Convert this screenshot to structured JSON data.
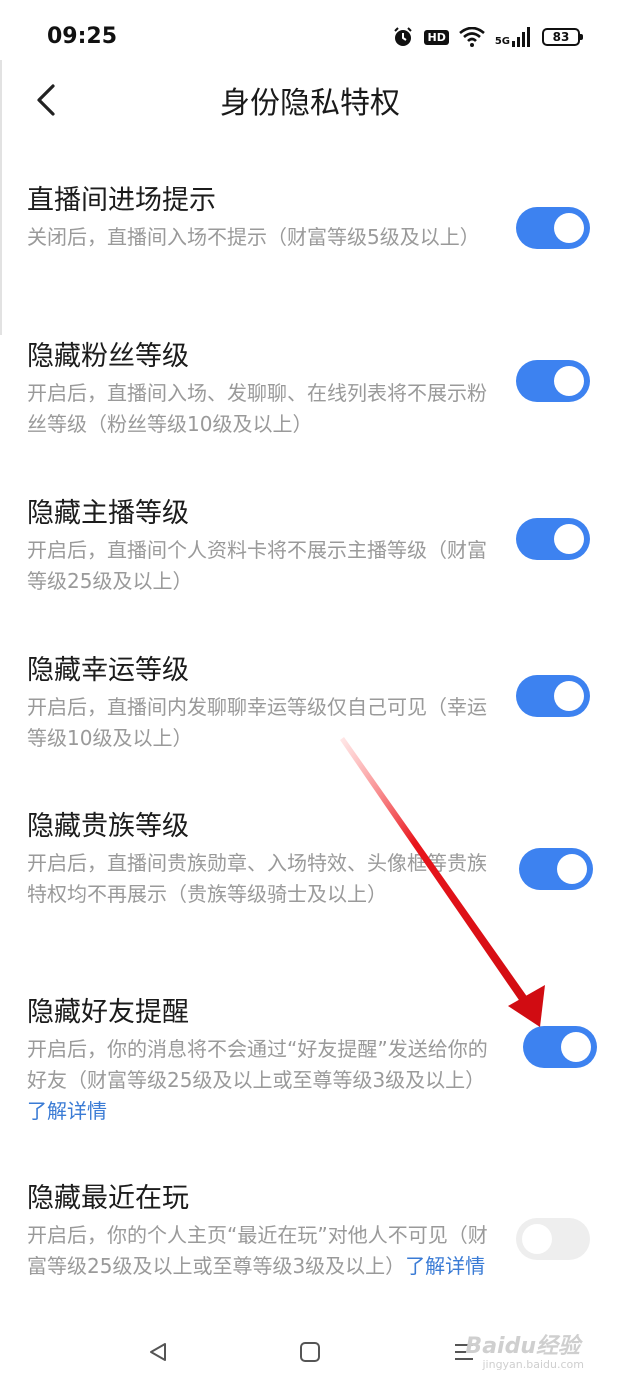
{
  "status": {
    "time": "09:25",
    "hd": "HD",
    "network": "5G",
    "battery": "83"
  },
  "header": {
    "title": "身份隐私特权"
  },
  "items": [
    {
      "title": "直播间进场提示",
      "desc": "关闭后，直播间入场不提示（财富等级5级及以上）",
      "link": "",
      "enabled": true
    },
    {
      "title": "隐藏粉丝等级",
      "desc": "开启后，直播间入场、发聊聊、在线列表将不展示粉丝等级（粉丝等级10级及以上）",
      "link": "",
      "enabled": true
    },
    {
      "title": "隐藏主播等级",
      "desc": "开启后，直播间个人资料卡将不展示主播等级（财富等级25级及以上）",
      "link": "",
      "enabled": true
    },
    {
      "title": "隐藏幸运等级",
      "desc": "开启后，直播间内发聊聊幸运等级仅自己可见（幸运等级10级及以上）",
      "link": "",
      "enabled": true
    },
    {
      "title": "隐藏贵族等级",
      "desc": "开启后，直播间贵族勋章、入场特效、头像框等贵族特权均不再展示（贵族等级骑士及以上）",
      "link": "",
      "enabled": true
    },
    {
      "title": "隐藏好友提醒",
      "desc": "开启后，你的消息将不会通过“好友提醒”发送给你的好友（财富等级25级及以上或至尊等级3级及以上）",
      "link": "了解详情",
      "enabled": true
    },
    {
      "title": "隐藏最近在玩",
      "desc": "开启后，你的个人主页“最近在玩”对他人不可见（财富等级25级及以上或至尊等级3级及以上）",
      "link": "了解详情",
      "enabled": false
    }
  ],
  "watermark": {
    "brand": "Baidu经验",
    "url": "jingyan.baidu.com"
  },
  "colors": {
    "toggle_on": "#3d82f0",
    "toggle_off": "#eeeeee",
    "link": "#3a7bd5",
    "annotation_arrow": "#e8141b"
  }
}
